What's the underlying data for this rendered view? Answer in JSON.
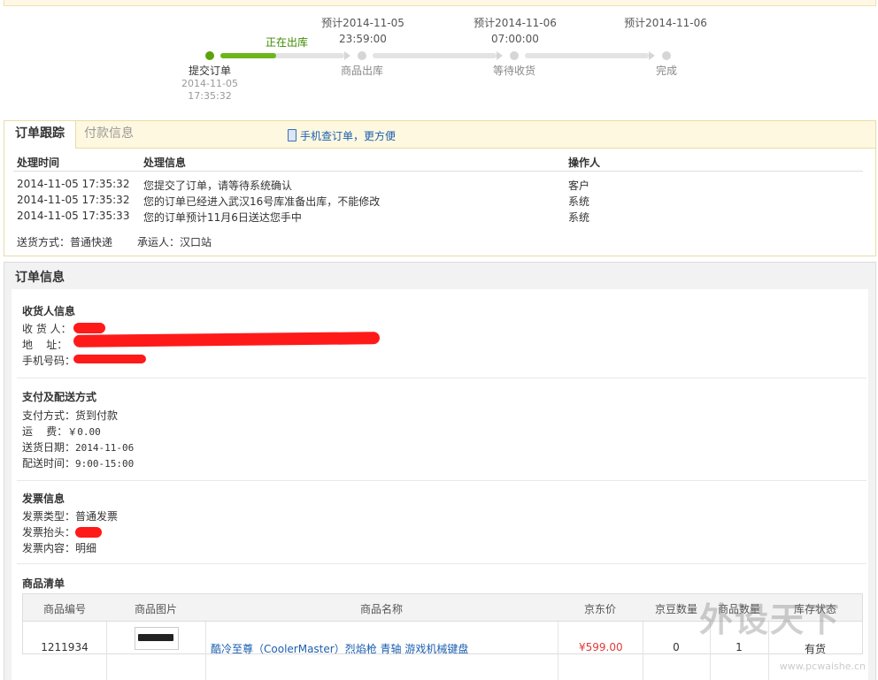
{
  "progress": {
    "current_label": "正在出库",
    "steps": [
      {
        "label": "提交订单",
        "date": "2014-11-05",
        "time": "17:35:32"
      },
      {
        "label": "商品出库",
        "eta_date": "预计2014-11-05",
        "eta_time": "23:59:00"
      },
      {
        "label": "等待收货",
        "eta_date": "预计2014-11-06",
        "eta_time": "07:00:00"
      },
      {
        "label": "完成",
        "eta_date": "预计2014-11-06"
      }
    ],
    "fill_fraction": 0.45,
    "colors": {
      "active": "#5ca20a",
      "inactive": "#d6d6d6"
    }
  },
  "tracking": {
    "tabs": [
      "订单跟踪",
      "付款信息"
    ],
    "mobile_link": "手机查订单，更方便",
    "headers": {
      "time": "处理时间",
      "info": "处理信息",
      "operator": "操作人"
    },
    "rows": [
      {
        "time": "2014-11-05 17:35:32",
        "info": "您提交了订单，请等待系统确认",
        "operator": "客户"
      },
      {
        "time": "2014-11-05 17:35:32",
        "info": "您的订单已经进入武汉16号库准备出库，不能修改",
        "operator": "系统"
      },
      {
        "time": "2014-11-05 17:35:33",
        "info": "您的订单预计11月6日送达您手中",
        "operator": "系统"
      }
    ],
    "shipping_method": "送货方式：普通快递",
    "carrier": "承运人：汉口站"
  },
  "order_info": {
    "title": "订单信息",
    "receiver": {
      "title": "收货人信息",
      "name_label": "收 货 人：",
      "address_label": "地    址：",
      "phone_label": "手机号码："
    },
    "payment": {
      "title": "支付及配送方式",
      "method": "支付方式：货到付款",
      "freight_label": "运    费：",
      "freight": "￥0.00",
      "date_label": "送货日期：",
      "date": "2014-11-06",
      "window_label": "配送时间：",
      "window": "9:00-15:00"
    },
    "invoice": {
      "title": "发票信息",
      "type": "发票类型：普通发票",
      "header_label": "发票抬头：",
      "content": "发票内容：明细"
    },
    "goods": {
      "title": "商品清单",
      "headers": [
        "商品编号",
        "商品图片",
        "商品名称",
        "京东价",
        "京豆数量",
        "商品数量",
        "库存状态"
      ],
      "items": [
        {
          "id": "1211934",
          "name": "酷冷至尊（CoolerMaster）烈焰枪 青轴 游戏机械键盘",
          "price": "¥599.00",
          "beans": "0",
          "qty": "1",
          "stock": "有货"
        }
      ]
    }
  },
  "watermark": {
    "brand": "外设天下",
    "url": "www.pcwaishe.cn"
  }
}
